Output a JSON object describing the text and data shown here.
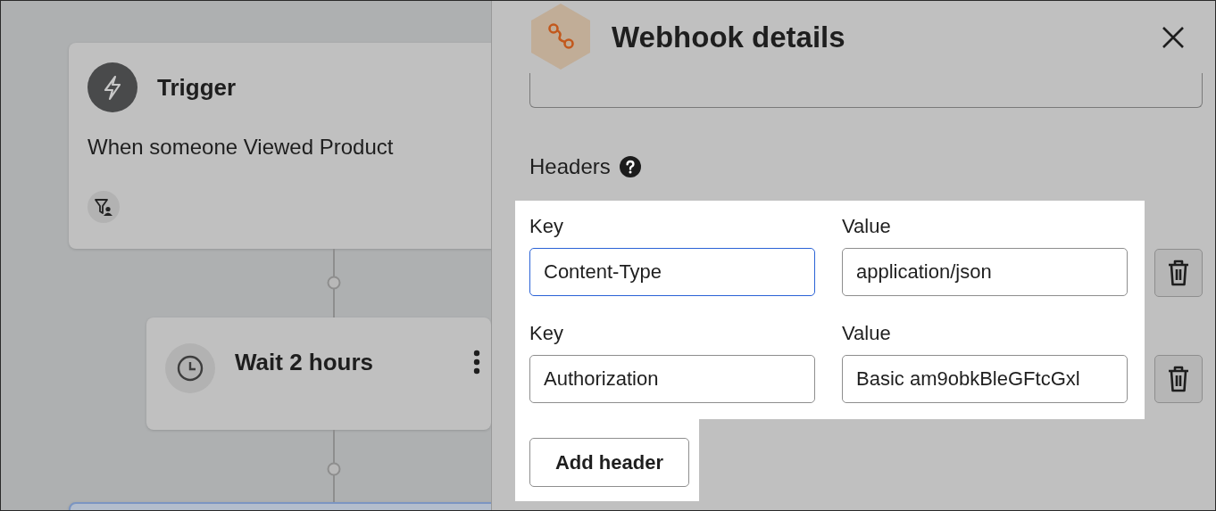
{
  "canvas": {
    "nodes": [
      {
        "kind": "trigger",
        "title": "Trigger",
        "description": "When someone Viewed Product"
      },
      {
        "kind": "delay",
        "title": "Wait 2 hours"
      },
      {
        "kind": "selected"
      }
    ]
  },
  "panel": {
    "title": "Webhook details",
    "section_label": "Headers",
    "headers": [
      {
        "key_label": "Key",
        "key": "Content-Type",
        "key_focused": true,
        "value_label": "Value",
        "value": "application/json"
      },
      {
        "key_label": "Key",
        "key": "Authorization",
        "key_focused": false,
        "value_label": "Value",
        "value": "Basic am9obkBleGFtcGxl"
      }
    ],
    "add_button": "Add header"
  }
}
